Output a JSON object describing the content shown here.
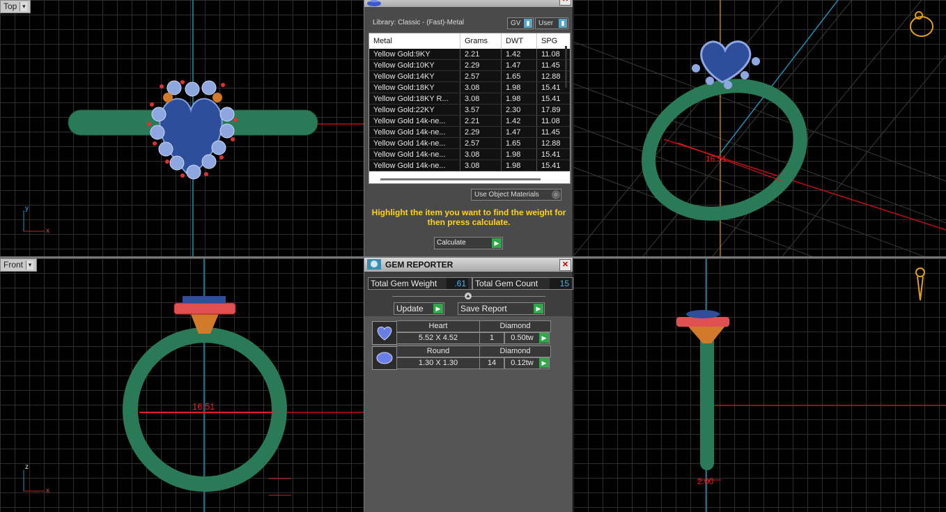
{
  "viewports": {
    "top_label": "Top",
    "front_label": "Front",
    "dim_ring_inner": "16.51",
    "dim_band_width": "2.00",
    "axis_x": "x",
    "axis_y": "y",
    "axis_z": "z"
  },
  "metal_weights": {
    "library": "Library: Classic - (Fast)-Metal",
    "gv_label": "GV",
    "user_label": "User",
    "columns": [
      "Metal",
      "Grams",
      "DWT",
      "SPG"
    ],
    "rows": [
      [
        "Yellow Gold:9KY",
        "2.21",
        "1.42",
        "11.08"
      ],
      [
        "Yellow Gold:10KY",
        "2.29",
        "1.47",
        "11.45"
      ],
      [
        "Yellow Gold:14KY",
        "2.57",
        "1.65",
        "12.88"
      ],
      [
        "Yellow Gold:18KY",
        "3.08",
        "1.98",
        "15.41"
      ],
      [
        "Yellow Gold:18KY R...",
        "3.08",
        "1.98",
        "15.41"
      ],
      [
        "Yellow Gold:22KY",
        "3.57",
        "2.30",
        "17.89"
      ],
      [
        "Yellow Gold 14k-ne...",
        "2.21",
        "1.42",
        "11.08"
      ],
      [
        "Yellow Gold 14k-ne...",
        "2.29",
        "1.47",
        "11.45"
      ],
      [
        "Yellow Gold 14k-ne...",
        "2.57",
        "1.65",
        "12.88"
      ],
      [
        "Yellow Gold 14k-ne...",
        "3.08",
        "1.98",
        "15.41"
      ],
      [
        "Yellow Gold 14k-ne...",
        "3.08",
        "1.98",
        "15.41"
      ]
    ],
    "use_object_materials": "Use Object Materials",
    "hint": "Highlight the item you want to find the weight for then press calculate.",
    "calculate_label": "Calculate"
  },
  "gem_reporter": {
    "title": "GEM REPORTER",
    "total_weight_label": "Total Gem Weight",
    "total_weight_value": ".61",
    "total_count_label": "Total Gem Count",
    "total_count_value": "15",
    "update_label": "Update",
    "save_report_label": "Save Report",
    "gems": [
      {
        "shape": "Heart",
        "type": "Diamond",
        "size": "5.52 X 4.52",
        "count": "1",
        "weight": "0.50tw"
      },
      {
        "shape": "Round",
        "type": "Diamond",
        "size": "1.30 X 1.30",
        "count": "14",
        "weight": "0.12tw"
      }
    ]
  },
  "colors": {
    "band": "#2b7a57",
    "gem": "#2e4e9c",
    "accent_yellow": "#ffd21e",
    "dimension": "#e02020"
  }
}
